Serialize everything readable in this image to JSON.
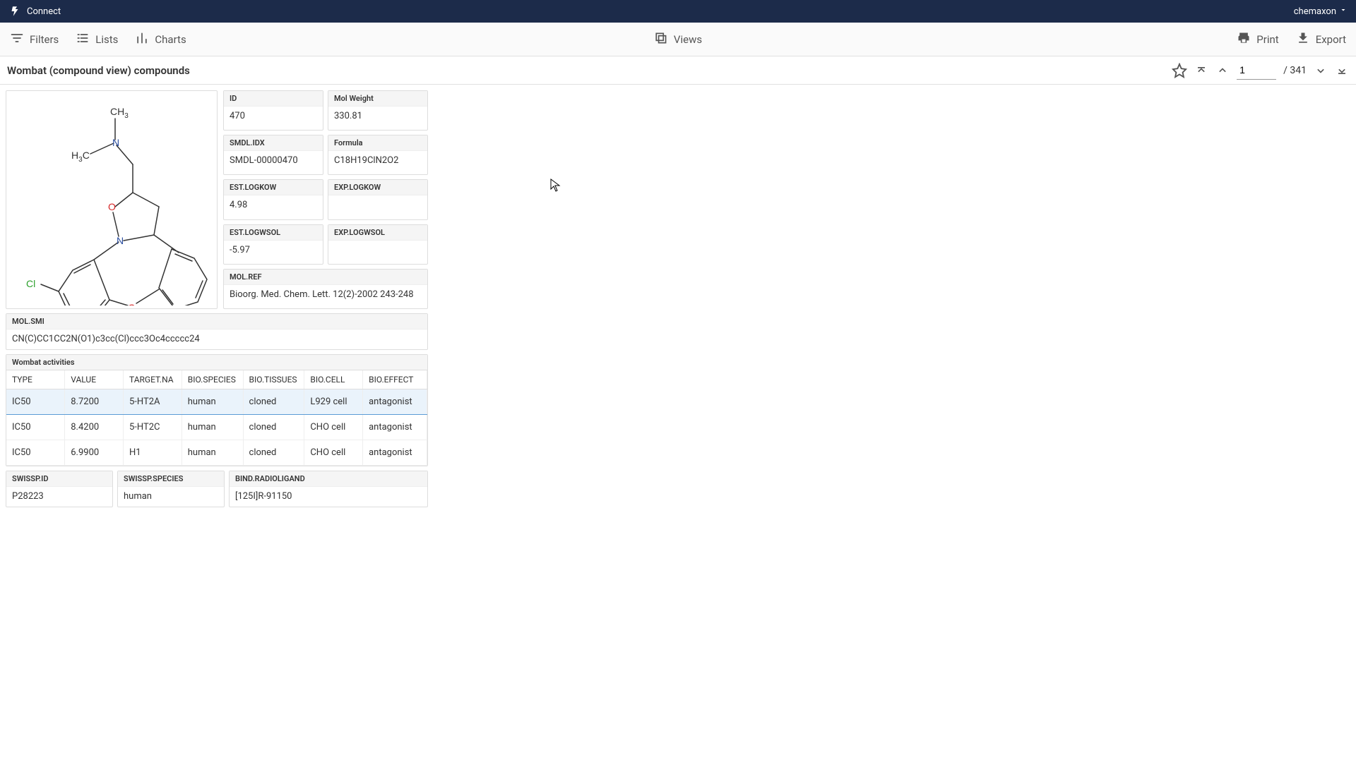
{
  "topbar": {
    "app_name": "Connect",
    "user": "chemaxon"
  },
  "toolbar": {
    "filters": "Filters",
    "lists": "Lists",
    "charts": "Charts",
    "views": "Views",
    "print": "Print",
    "export": "Export"
  },
  "titlebar": {
    "title": "Wombat (compound view) compounds",
    "page_current": "1",
    "page_total": "/ 341"
  },
  "fields": {
    "id": {
      "label": "ID",
      "value": "470"
    },
    "molweight": {
      "label": "Mol Weight",
      "value": "330.81"
    },
    "smdlidx": {
      "label": "SMDL.IDX",
      "value": "SMDL-00000470"
    },
    "formula": {
      "label": "Formula",
      "value": "C18H19ClN2O2"
    },
    "estlogkow": {
      "label": "EST.LOGKOW",
      "value": "4.98"
    },
    "explogkow": {
      "label": "EXP.LOGKOW",
      "value": ""
    },
    "estlogwsol": {
      "label": "EST.LOGWSOL",
      "value": "-5.97"
    },
    "explogwsol": {
      "label": "EXP.LOGWSOL",
      "value": ""
    },
    "molref": {
      "label": "MOL.REF",
      "value": "Bioorg. Med. Chem. Lett. 12(2)-2002 243-248"
    },
    "molsmi": {
      "label": "MOL.SMI",
      "value": "CN(C)CC1CC2N(O1)c3cc(Cl)ccc3Oc4ccccc24"
    }
  },
  "activities": {
    "title": "Wombat activities",
    "columns": [
      "TYPE",
      "VALUE",
      "TARGET.NA",
      "BIO.SPECIES",
      "BIO.TISSUES",
      "BIO.CELL",
      "BIO.EFFECT"
    ],
    "rows": [
      {
        "type": "IC50",
        "value": "8.7200",
        "target": "5-HT2A",
        "species": "human",
        "tissues": "cloned",
        "cell": "L929 cell",
        "effect": "antagonist",
        "selected": true
      },
      {
        "type": "IC50",
        "value": "8.4200",
        "target": "5-HT2C",
        "species": "human",
        "tissues": "cloned",
        "cell": "CHO cell",
        "effect": "antagonist",
        "selected": false
      },
      {
        "type": "IC50",
        "value": "6.9900",
        "target": "H1",
        "species": "human",
        "tissues": "cloned",
        "cell": "CHO cell",
        "effect": "antagonist",
        "selected": false
      }
    ]
  },
  "bottom": {
    "swisspid": {
      "label": "SWISSP.ID",
      "value": "P28223"
    },
    "swisspspecies": {
      "label": "SWISSP.SPECIES",
      "value": "human"
    },
    "bindradioligand": {
      "label": "BIND.RADIOLIGAND",
      "value": "[125I]R-91150"
    }
  },
  "structure": {
    "atoms": {
      "ch3": "CH",
      "h3c": "H",
      "c_sub": "C",
      "three_sub": "3",
      "n1": "N",
      "n2": "N",
      "o1": "O",
      "o2": "O",
      "cl": "Cl"
    }
  }
}
